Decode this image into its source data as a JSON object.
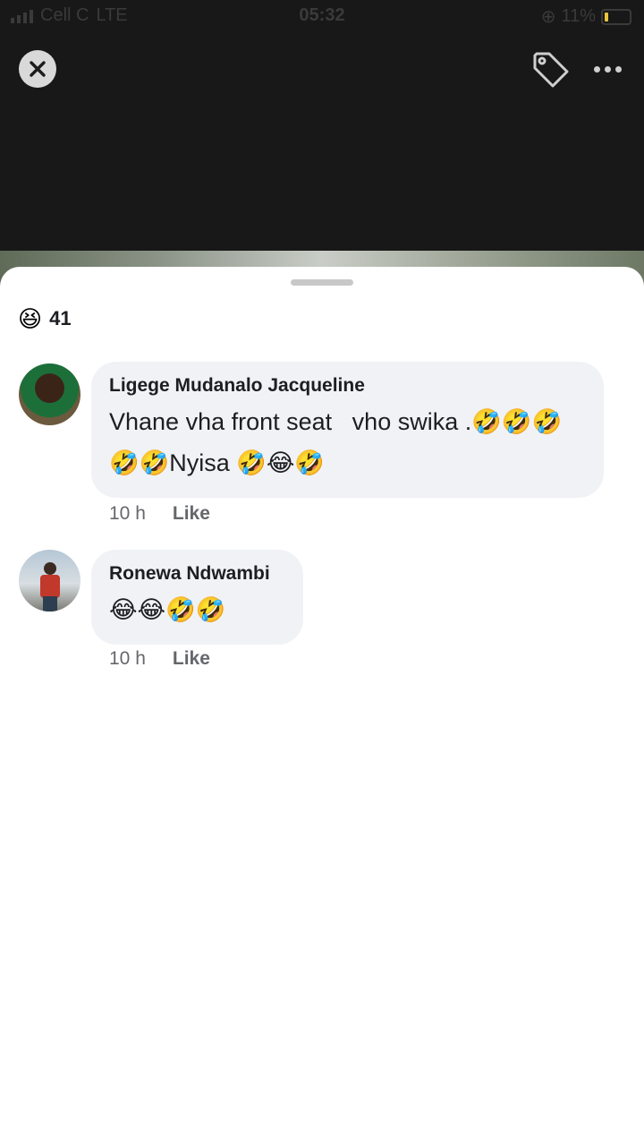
{
  "status_bar": {
    "carrier": "Cell C",
    "network": "LTE",
    "time": "05:32",
    "battery_percent": "11%"
  },
  "top_bar": {
    "close_icon": "close-icon",
    "tag_icon": "tag-icon",
    "more_icon": "more-dots-icon"
  },
  "reactions": {
    "emoji": "😆",
    "count": "41"
  },
  "comments": [
    {
      "author": "Ligege Mudanalo Jacqueline",
      "text": "Vhane vha front seat   vho swika .🤣🤣🤣\n🤣🤣Nyisa 🤣😂🤣",
      "time": "10 h",
      "like_label": "Like"
    },
    {
      "author": "Ronewa Ndwambi",
      "text": "😂😂🤣🤣",
      "time": "10 h",
      "like_label": "Like"
    }
  ],
  "colors": {
    "bubble_bg": "#f0f2f5",
    "meta_text": "#65676b",
    "primary_text": "#1c1e21"
  }
}
